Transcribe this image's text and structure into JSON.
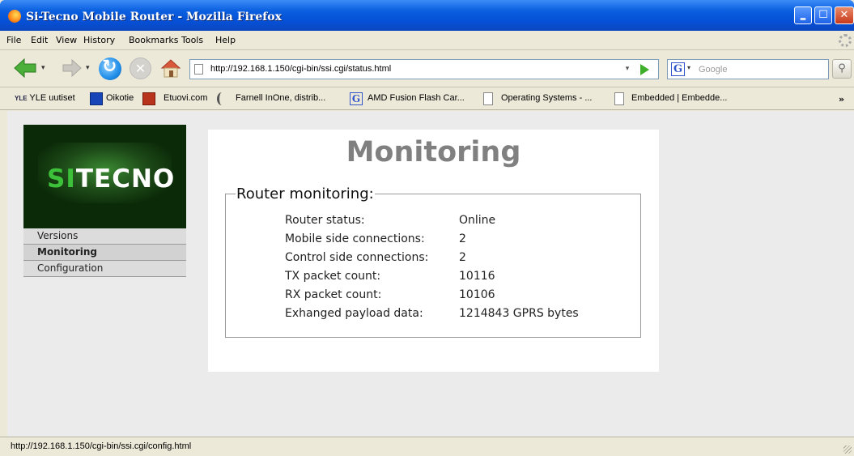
{
  "window": {
    "title": "Si-Tecno Mobile Router - Mozilla Firefox",
    "min_glyph": "‗",
    "max_glyph": "☐",
    "close_glyph": "✕"
  },
  "menu": [
    "File",
    "Edit",
    "View",
    "History",
    "Bookmarks",
    "Tools",
    "Help"
  ],
  "toolbar": {
    "url": "http://192.168.1.150/cgi-bin/ssi.cgi/status.html",
    "search_placeholder": "Google",
    "search_engine_glyph": "G",
    "stop_glyph": "✕",
    "search_glyph": "⚲",
    "dropdown_glyph": "▾"
  },
  "bookmarks": [
    {
      "icon": "yle-icon",
      "badge": "YLE",
      "label": "YLE uutiset"
    },
    {
      "icon": "oikotie-icon",
      "badge": "",
      "label": "Oikotie"
    },
    {
      "icon": "etuovi-icon",
      "badge": "",
      "label": "Etuovi.com"
    },
    {
      "icon": "farnell-icon",
      "badge": "",
      "label": "Farnell InOne, distrib..."
    },
    {
      "icon": "google-icon",
      "badge": "G",
      "label": "AMD Fusion Flash Car..."
    },
    {
      "icon": "page-icon",
      "badge": "",
      "label": "Operating Systems - ..."
    },
    {
      "icon": "page-icon",
      "badge": "",
      "label": "Embedded | Embedde..."
    }
  ],
  "bookmarks_more": "»",
  "logo": {
    "si": "SI",
    "rest": "TECNO"
  },
  "sidebar": {
    "items": [
      {
        "label": "Versions",
        "active": false
      },
      {
        "label": "Monitoring",
        "active": true
      },
      {
        "label": "Configuration",
        "active": false
      }
    ]
  },
  "page": {
    "heading": "Monitoring",
    "legend": "Router monitoring:",
    "rows": [
      {
        "label": "Router status:",
        "value": "Online"
      },
      {
        "label": "Mobile side connections:",
        "value": "2"
      },
      {
        "label": "Control side connections:",
        "value": "2"
      },
      {
        "label": "TX packet count:",
        "value": "10116"
      },
      {
        "label": "RX packet count:",
        "value": "10106"
      },
      {
        "label": "Exhanged payload data:",
        "value": "1214843 GPRS bytes"
      }
    ]
  },
  "status": {
    "text": "http://192.168.1.150/cgi-bin/ssi.cgi/config.html"
  },
  "colors": {
    "xp_blue": "#0550d6",
    "logo_green": "#3ec13a",
    "heading_gray": "#808080"
  }
}
